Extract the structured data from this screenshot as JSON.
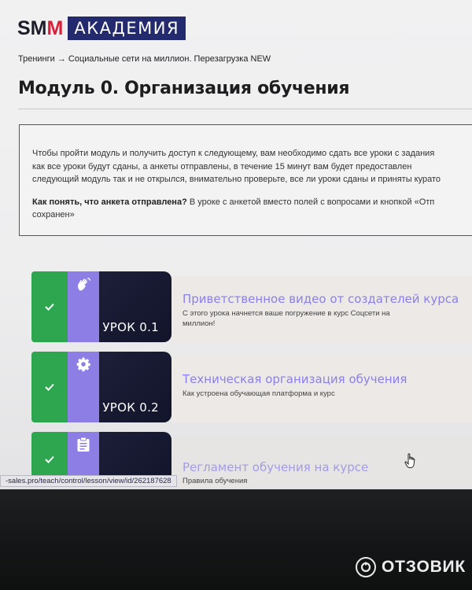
{
  "logo": {
    "smm_text_main": "SM",
    "smm_text_red": "M",
    "akademia": "АКАДЕМИЯ"
  },
  "breadcrumb": "Тренинги → Социальные сети на миллион. Перезагрузка NEW",
  "page_title": "Модуль 0. Организация обучения",
  "info": {
    "lines": [
      "Чтобы пройти модуль и получить доступ к следующему, вам необходимо сдать все уроки с задания",
      "как все уроки будут сданы, а анкеты отправлены, в течение 15 минут вам будет предоставлен",
      "следующий модуль так и не открылся, внимательно проверьте, все ли уроки сданы и приняты курато"
    ],
    "question_bold": "Как понять, что анкета отправлена?",
    "question_rest": " В уроке с анкетой вместо полей с вопросами и кнопкой «Отп",
    "question_line2": "сохранен»"
  },
  "lessons": [
    {
      "label": "УРОК 0.1",
      "title": "Приветственное видео от создателей курса",
      "desc": "С этого урока начнется ваше погружение в курс Соцсети на миллион!",
      "icon": "waving-hand-icon",
      "check_icon": "check-icon"
    },
    {
      "label": "УРОК 0.2",
      "title": "Техническая организация обучения",
      "desc": "Как устроена обучающая платформа и курс",
      "icon": "gear-icon",
      "check_icon": "check-icon"
    },
    {
      "label": "",
      "title": "Регламент обучения на курсе",
      "desc": "Правила обучения",
      "icon": "clipboard-icon",
      "check_icon": "check-icon"
    }
  ],
  "status_url": "-sales.pro/teach/control/lesson/view/id/262187628",
  "watermark": "ОТЗОВИК",
  "colors": {
    "brand_navy": "#232a6e",
    "brand_red": "#d8203a",
    "done_green": "#2ea64f",
    "lesson_purple": "#8d7ee6",
    "lesson_title": "#8c80e8"
  }
}
